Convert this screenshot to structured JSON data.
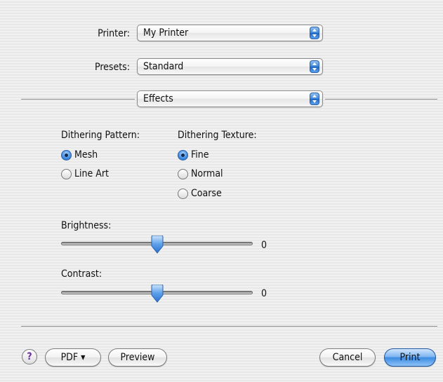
{
  "printer": {
    "label": "Printer:",
    "value": "My Printer"
  },
  "presets": {
    "label": "Presets:",
    "value": "Standard"
  },
  "panel": {
    "value": "Effects"
  },
  "dithering_pattern": {
    "label": "Dithering Pattern:",
    "options": [
      {
        "label": "Mesh",
        "selected": true
      },
      {
        "label": "Line Art",
        "selected": false
      }
    ]
  },
  "dithering_texture": {
    "label": "Dithering Texture:",
    "options": [
      {
        "label": "Fine",
        "selected": true
      },
      {
        "label": "Normal",
        "selected": false
      },
      {
        "label": "Coarse",
        "selected": false
      }
    ]
  },
  "brightness": {
    "label": "Brightness:",
    "value": "0",
    "level": 0.5
  },
  "contrast": {
    "label": "Contrast:",
    "value": "0",
    "level": 0.5
  },
  "buttons": {
    "help": "?",
    "pdf": "PDF ▾",
    "preview": "Preview",
    "cancel": "Cancel",
    "print": "Print"
  },
  "icons": {
    "popup_arrows": "up-down-arrows-icon",
    "slider_thumb": "slider-thumb-icon"
  },
  "colors": {
    "accent": "#3c8be3",
    "background": "#ececec"
  }
}
